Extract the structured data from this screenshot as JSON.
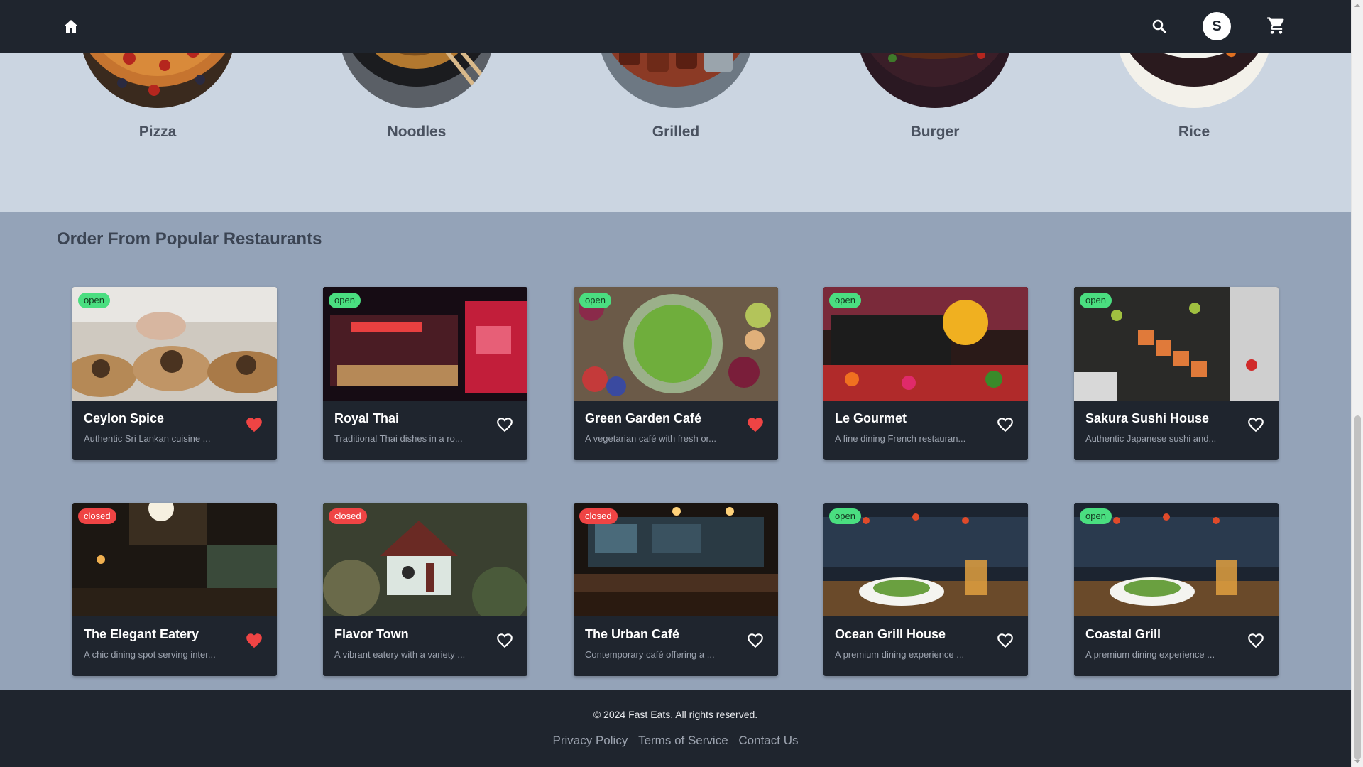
{
  "navbar": {
    "avatar_initial": "S"
  },
  "categories": [
    {
      "label": "Pizza"
    },
    {
      "label": "Noodles"
    },
    {
      "label": "Grilled"
    },
    {
      "label": "Burger"
    },
    {
      "label": "Rice"
    }
  ],
  "restaurants": {
    "title": "Order From Popular Restaurants",
    "items": [
      {
        "name": "Ceylon Spice",
        "desc": "Authentic Sri Lankan cuisine ...",
        "status": "open",
        "favorite": true
      },
      {
        "name": "Royal Thai",
        "desc": "Traditional Thai dishes in a ro...",
        "status": "open",
        "favorite": false
      },
      {
        "name": "Green Garden Café",
        "desc": "A vegetarian café with fresh or...",
        "status": "open",
        "favorite": true
      },
      {
        "name": "Le Gourmet",
        "desc": "A fine dining French restauran...",
        "status": "open",
        "favorite": false
      },
      {
        "name": "Sakura Sushi House",
        "desc": "Authentic Japanese sushi and...",
        "status": "open",
        "favorite": false
      },
      {
        "name": "The Elegant Eatery",
        "desc": "A chic dining spot serving inter...",
        "status": "closed",
        "favorite": true
      },
      {
        "name": "Flavor Town",
        "desc": "A vibrant eatery with a variety ...",
        "status": "closed",
        "favorite": false
      },
      {
        "name": "The Urban Café",
        "desc": "Contemporary café offering a ...",
        "status": "closed",
        "favorite": false
      },
      {
        "name": "Ocean Grill House",
        "desc": "A premium dining experience ...",
        "status": "open",
        "favorite": false
      },
      {
        "name": "Coastal Grill",
        "desc": "A premium dining experience ...",
        "status": "open",
        "favorite": false
      }
    ]
  },
  "footer": {
    "copyright": "© 2024 Fast Eats. All rights reserved.",
    "links": [
      "Privacy Policy",
      "Terms of Service",
      "Contact Us"
    ]
  },
  "colors": {
    "navbar_bg": "#1f252e",
    "category_band_bg": "#cbd5e1",
    "section_bg": "#94a3b8",
    "open_badge": "#4ade80",
    "closed_badge": "#ef4444",
    "favorite_heart": "#ef4444"
  }
}
